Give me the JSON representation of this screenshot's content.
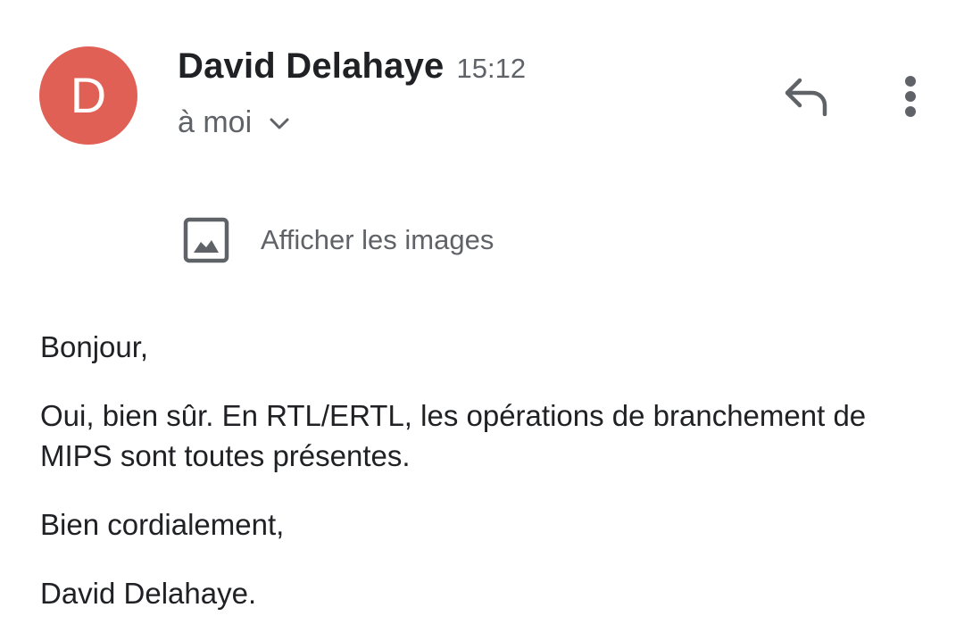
{
  "sender": {
    "avatar_letter": "D",
    "avatar_color": "#e06055",
    "name": "David Delahaye",
    "time": "15:12",
    "recipient": "à moi"
  },
  "actions": {
    "reply_icon": "reply-icon",
    "more_icon": "more-vert-icon",
    "expand_icon": "chevron-down-icon"
  },
  "images_banner": {
    "icon": "image-icon",
    "label": "Afficher les images"
  },
  "body": {
    "greeting": "Bonjour,",
    "paragraph": "Oui, bien sûr. En RTL/ERTL, les opérations de branchement de MIPS sont toutes présentes.",
    "closing": "Bien cordialement,",
    "signature": "David Delahaye."
  }
}
